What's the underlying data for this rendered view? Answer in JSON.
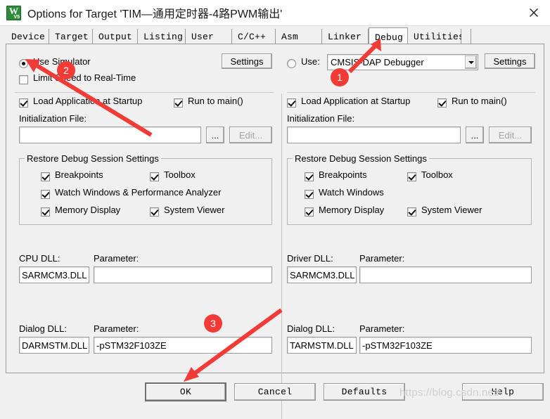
{
  "window": {
    "title": "Options for Target 'TIM—通用定时器-4路PWM输出'",
    "app_icon": "keil-uvision-icon",
    "icon_letter": "W",
    "icon_version": "V5",
    "close_label": "×"
  },
  "tabs": [
    {
      "label": "Device",
      "selected": false
    },
    {
      "label": "Target",
      "selected": false
    },
    {
      "label": "Output",
      "selected": false
    },
    {
      "label": "Listing",
      "selected": false
    },
    {
      "label": "User",
      "selected": false
    },
    {
      "label": "C/C++",
      "selected": false
    },
    {
      "label": "Asm",
      "selected": false
    },
    {
      "label": "Linker",
      "selected": false
    },
    {
      "label": "Debug",
      "selected": true
    },
    {
      "label": "Utilities",
      "selected": false
    }
  ],
  "left_pane": {
    "use_simulator": {
      "label": "Use Simulator",
      "checked": true
    },
    "limit_speed": {
      "label": "Limit Speed to Real-Time",
      "checked": false
    },
    "settings_button": "Settings",
    "load_app": {
      "label": "Load Application at Startup",
      "checked": true
    },
    "run_to_main": {
      "label": "Run to main()",
      "checked": true
    },
    "init_file_label": "Initialization File:",
    "init_file_value": "",
    "browse_button": "...",
    "edit_button": "Edit...",
    "restore_group": {
      "title": "Restore Debug Session Settings",
      "items": [
        {
          "label": "Breakpoints",
          "checked": true
        },
        {
          "label": "Toolbox",
          "checked": true
        },
        {
          "label": "Watch Windows & Performance Analyzer",
          "checked": true
        },
        {
          "label": "Memory Display",
          "checked": true
        },
        {
          "label": "System Viewer",
          "checked": true
        }
      ]
    },
    "cpu_dll_label": "CPU DLL:",
    "cpu_dll_value": "SARMCM3.DLL",
    "cpu_param_label": "Parameter:",
    "cpu_param_value": "",
    "dialog_dll_label": "Dialog DLL:",
    "dialog_dll_value": "DARMSTM.DLL",
    "dialog_param_label": "Parameter:",
    "dialog_param_value": "-pSTM32F103ZE"
  },
  "right_pane": {
    "use_radio": {
      "label": "Use:",
      "checked": false
    },
    "debugger_select": {
      "value": "CMSIS-DAP Debugger"
    },
    "settings_button": "Settings",
    "load_app": {
      "label": "Load Application at Startup",
      "checked": true
    },
    "run_to_main": {
      "label": "Run to main()",
      "checked": true
    },
    "init_file_label": "Initialization File:",
    "init_file_value": "",
    "browse_button": "...",
    "edit_button": "Edit...",
    "restore_group": {
      "title": "Restore Debug Session Settings",
      "items": [
        {
          "label": "Breakpoints",
          "checked": true
        },
        {
          "label": "Toolbox",
          "checked": true
        },
        {
          "label": "Watch Windows",
          "checked": true
        },
        {
          "label": "Memory Display",
          "checked": true
        },
        {
          "label": "System Viewer",
          "checked": true
        }
      ]
    },
    "driver_dll_label": "Driver DLL:",
    "driver_dll_value": "SARMCM3.DLL",
    "driver_param_label": "Parameter:",
    "driver_param_value": "",
    "dialog_dll_label": "Dialog DLL:",
    "dialog_dll_value": "TARMSTM.DLL",
    "dialog_param_label": "Parameter:",
    "dialog_param_value": "-pSTM32F103ZE"
  },
  "footer": {
    "ok": "OK",
    "cancel": "Cancel",
    "defaults": "Defaults",
    "help": "Help"
  },
  "annotations": {
    "badge1": "1",
    "badge2": "2",
    "badge3": "3",
    "accent_color": "#f23b36"
  },
  "watermark": "https://blog.csdn.net/"
}
